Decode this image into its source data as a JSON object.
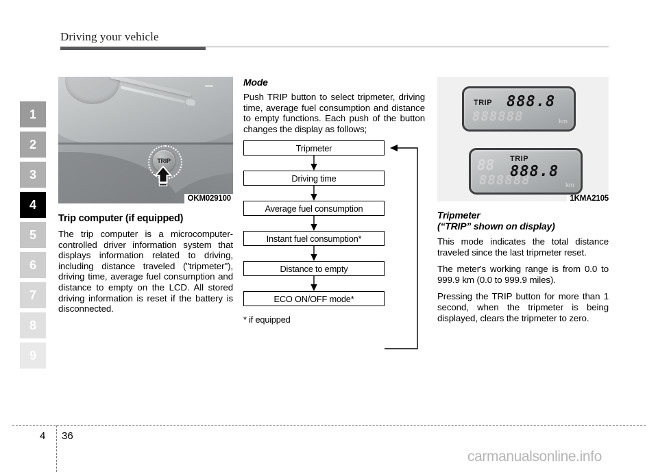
{
  "header": {
    "title": "Driving your vehicle"
  },
  "chapter_rail": {
    "tabs": [
      {
        "label": "1",
        "color": "#9b9b9b"
      },
      {
        "label": "2",
        "color": "#a5a5a5"
      },
      {
        "label": "3",
        "color": "#b0b0b0"
      },
      {
        "label": "4",
        "color": "#000000"
      },
      {
        "label": "5",
        "color": "#c5c5c5"
      },
      {
        "label": "6",
        "color": "#cecece"
      },
      {
        "label": "7",
        "color": "#d7d7d7"
      },
      {
        "label": "8",
        "color": "#e0e0e0"
      },
      {
        "label": "9",
        "color": "#e9e9e9"
      }
    ]
  },
  "left_column": {
    "figure": {
      "caption": "OKM029100",
      "button_label": "TRIP"
    },
    "heading": "Trip computer (if equipped)",
    "paragraph": "The trip computer is a microcomputer-controlled driver information system that displays information related to driving, including distance traveled (\"tripmeter\"), driving time, average fuel consumption and distance to empty on the LCD. All stored driving information is reset if the battery is disconnected."
  },
  "middle_column": {
    "heading": "Mode",
    "paragraph": "Push TRIP button to select tripmeter, driving time, average fuel consumption and distance to empty functions. Each push of the button changes the display as follows;",
    "flow_steps": [
      "Tripmeter",
      "Driving time",
      "Average fuel consumption",
      "Instant fuel consumption*",
      "Distance to empty",
      "ECO ON/OFF mode*"
    ],
    "footnote": "* if equipped"
  },
  "right_column": {
    "figure": {
      "caption": "1KMA2105",
      "display_top": {
        "trip_label": "TRIP",
        "digits": "888.8",
        "ghost_digits": "888888",
        "unit": "km"
      },
      "display_bottom": {
        "ghost_segment": "88",
        "trip_label": "TRIP",
        "digits": "888.8",
        "ghost_digits": "888888",
        "unit": "km"
      }
    },
    "heading_line1": "Tripmeter",
    "heading_line2": "(“TRIP” shown on display)",
    "paragraph1": "This mode indicates the total distance traveled since the last tripmeter reset.",
    "paragraph2": "The meter's working range is from 0.0 to 999.9 km (0.0 to 999.9 miles).",
    "paragraph3": "Pressing the TRIP button for more than 1 second, when the tripmeter is being displayed, clears the tripmeter to zero."
  },
  "footer": {
    "chapter": "4",
    "page": "36",
    "watermark": "carmanualsonline.info"
  }
}
